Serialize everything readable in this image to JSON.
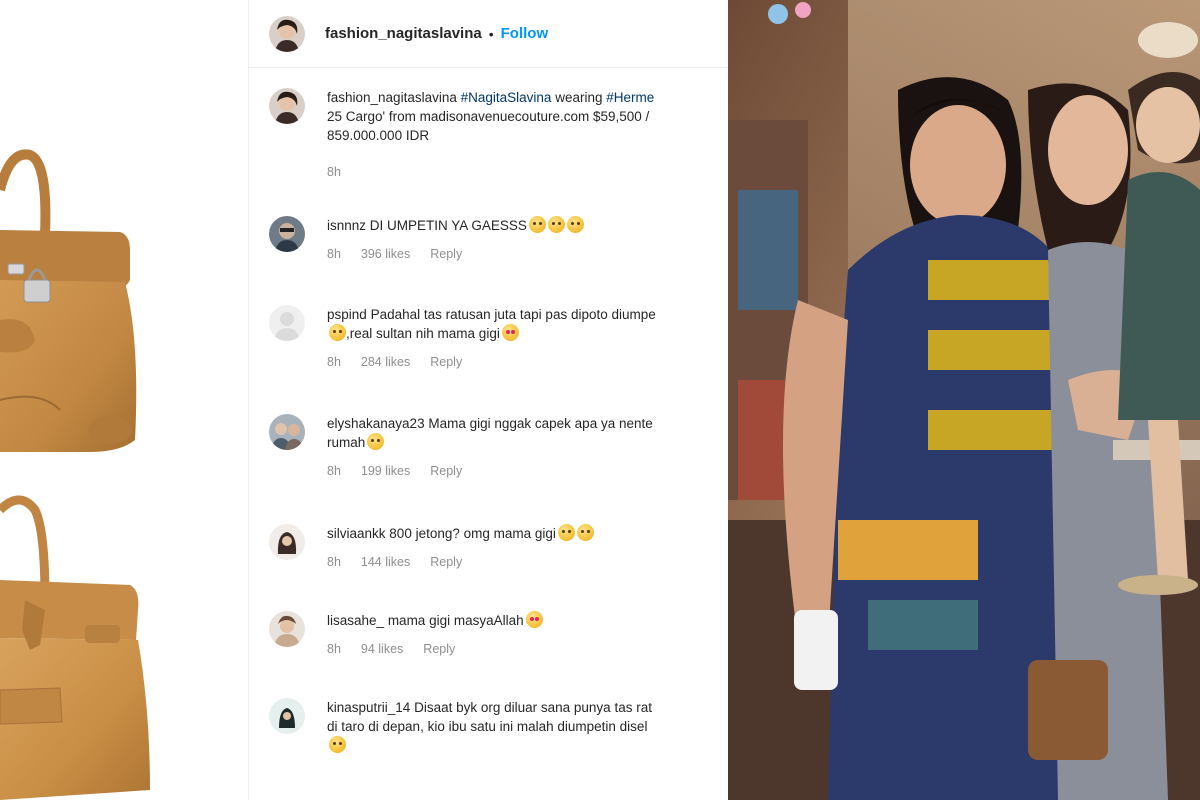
{
  "post": {
    "username": "fashion_nagitaslavina",
    "separator": "•",
    "follow_label": "Follow"
  },
  "caption": {
    "username": "fashion_nagitaslavina",
    "tag1": "#NagitaSlavina",
    "text1": " wearing ",
    "tag2": "#Herme",
    "line2": "25 Cargo' from madisonavenuecouture.com $59,500 /",
    "line3": "859.000.000 IDR",
    "time": "8h"
  },
  "comments": [
    {
      "username": "isnnnz",
      "text": "DI UMPETIN YA GAESSS",
      "emojis": 3,
      "line2": "",
      "time": "8h",
      "likes": "396 likes",
      "reply": "Reply"
    },
    {
      "username": "pspind",
      "text": "Padahal tas ratusan juta tapi pas dipoto diumpe",
      "emojis": 0,
      "line2": ",real sultan nih mama gigi",
      "time": "8h",
      "likes": "284 likes",
      "reply": "Reply"
    },
    {
      "username": "elyshakanaya23",
      "text": "Mama gigi nggak capek apa ya nente",
      "emojis": 0,
      "line2": "rumah",
      "time": "8h",
      "likes": "199 likes",
      "reply": "Reply"
    },
    {
      "username": "silviaankk",
      "text": "800 jetong? omg mama gigi",
      "emojis": 2,
      "line2": "",
      "time": "8h",
      "likes": "144 likes",
      "reply": "Reply"
    },
    {
      "username": "lisasahe_",
      "text": "mama gigi masyaAllah",
      "emojis": 1,
      "line2": "",
      "time": "8h",
      "likes": "94 likes",
      "reply": "Reply"
    },
    {
      "username": "kinasputrii_14",
      "text": "Disaat byk org diluar sana punya tas rat",
      "emojis": 0,
      "line2": "di taro di depan, kio ibu satu ini malah diumpetin disel",
      "time": "",
      "likes": "",
      "reply": ""
    }
  ],
  "icons": {
    "bag_top": "birkin-bag-lock",
    "bag_bottom": "birkin-bag",
    "emoji": "laughing-crying-emoji"
  },
  "colors": {
    "follow": "#0095f6",
    "meta_text": "#8e8e8e",
    "bag_tan": "#c98e45"
  }
}
